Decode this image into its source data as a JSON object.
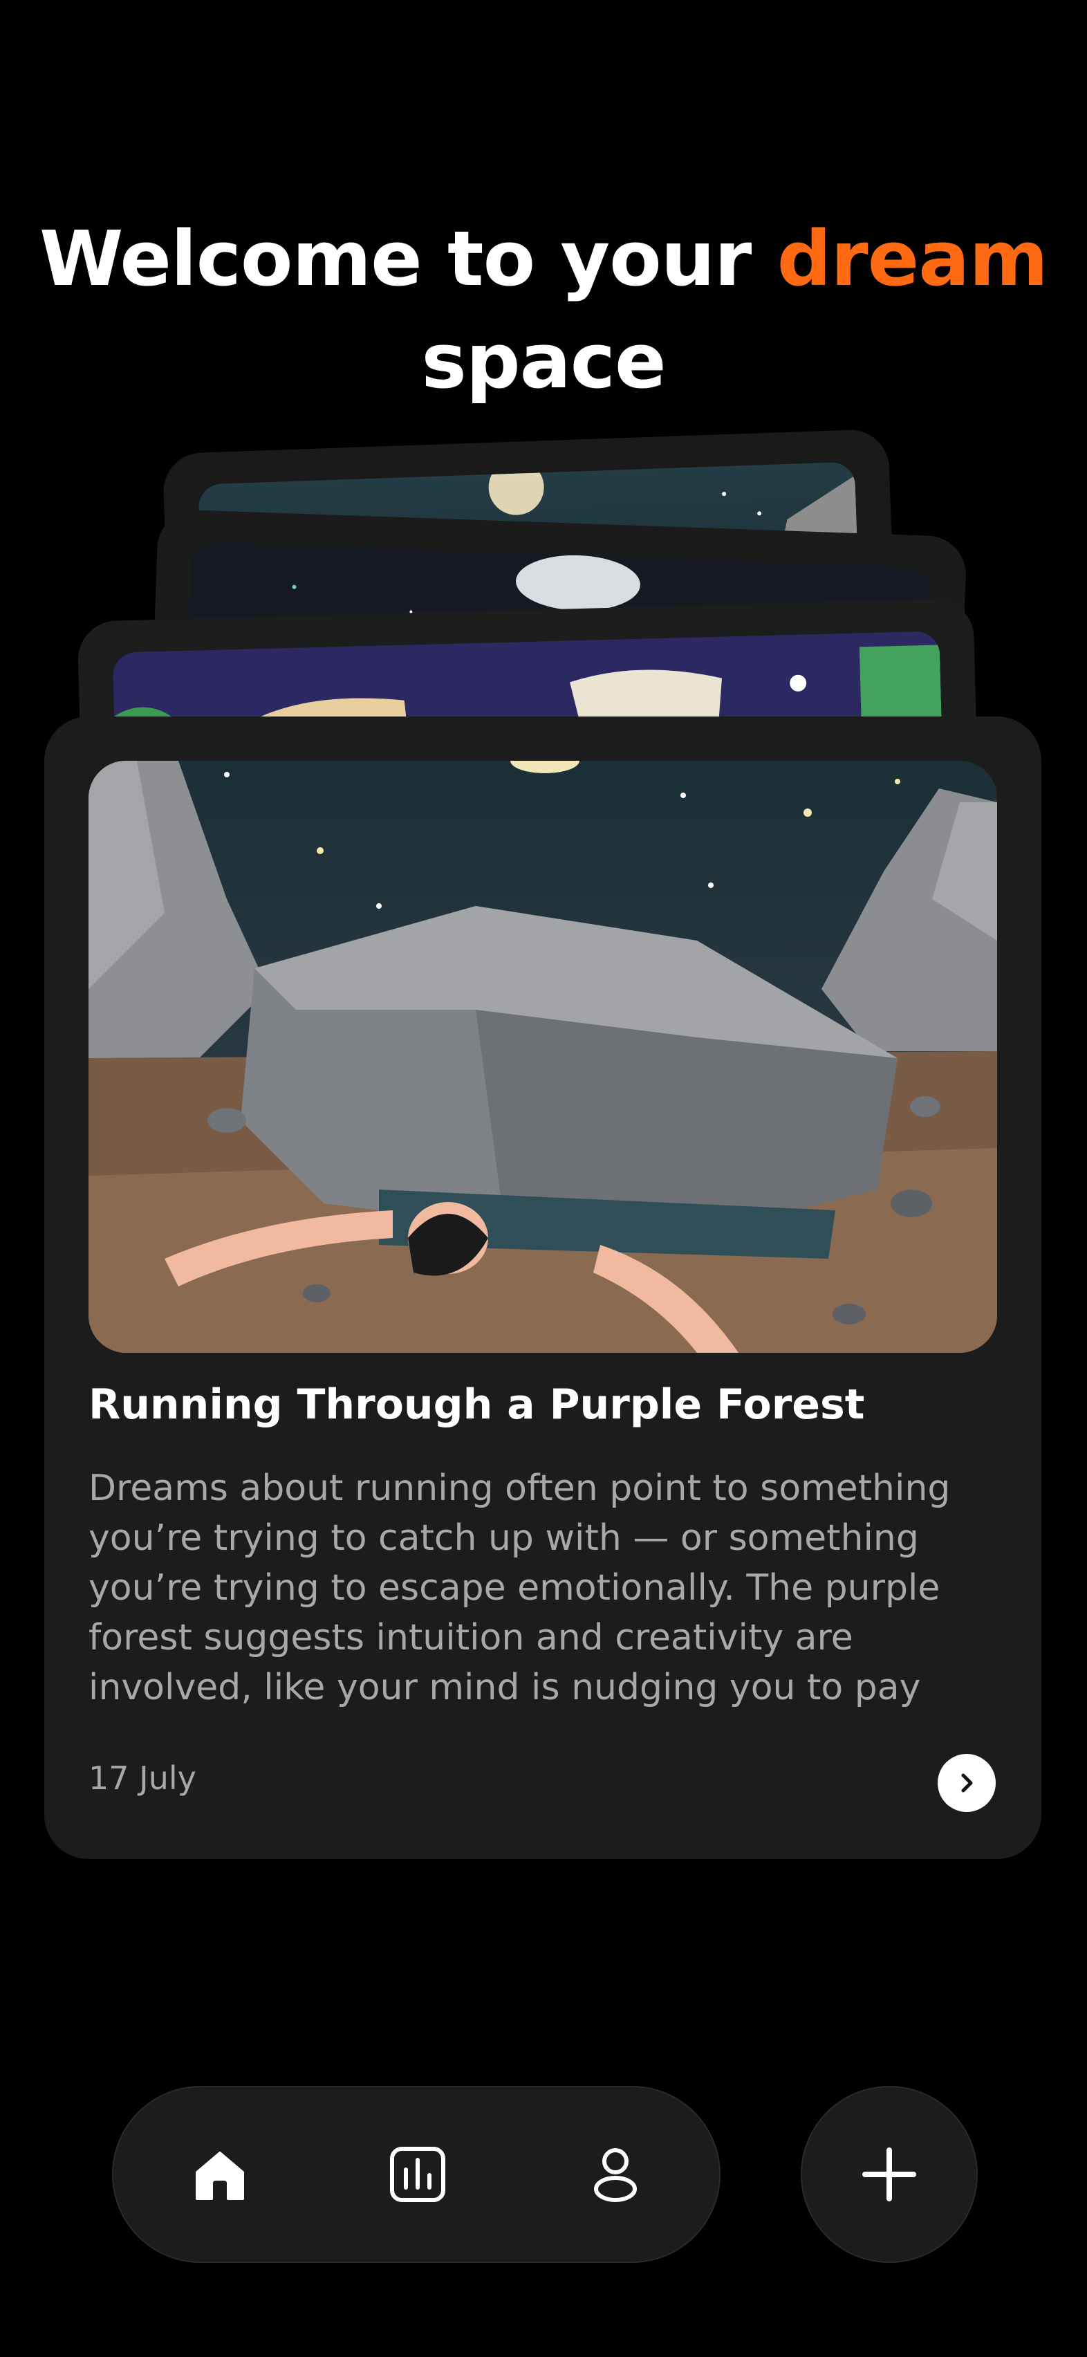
{
  "header": {
    "title_part1": "Welcome to your ",
    "title_accent": "dream",
    "title_part2": "space"
  },
  "featured_card": {
    "title": "Running Through a Purple Forest",
    "body": "Dreams about running often point to something you’re trying to catch up with — or something you’re trying to escape emotionally. The purple forest suggests intuition and creativity are involved, like your mind is nudging you to pay atte…",
    "date": "17 July",
    "image_icon": "dream-illustration-boulder",
    "next_icon": "chevron-right-icon"
  },
  "bottom_nav": {
    "items": [
      {
        "icon": "home-icon",
        "active": true
      },
      {
        "icon": "stats-icon",
        "active": false
      },
      {
        "icon": "profile-icon",
        "active": false
      }
    ],
    "fab_icon": "plus-icon"
  },
  "colors": {
    "accent": "#ff6a13",
    "background": "#000000",
    "card": "#1c1c1c",
    "muted_text": "#a8a8a8"
  }
}
